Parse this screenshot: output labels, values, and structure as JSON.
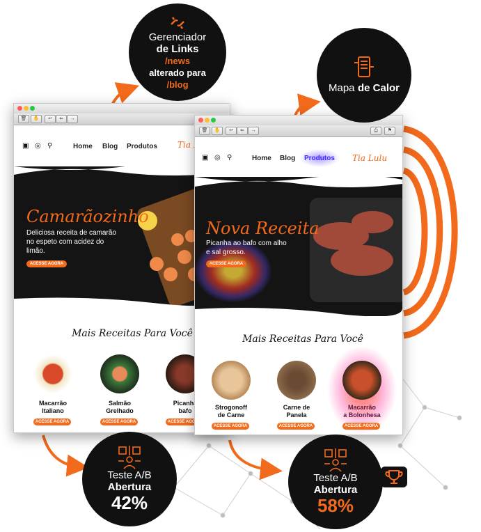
{
  "colors": {
    "accent": "#f26a1b",
    "dark": "#111111",
    "heat": "#6a4cff"
  },
  "callouts": {
    "links": {
      "line1": "Gerenciador",
      "line2": "de Links",
      "line3": "/news",
      "line4": "alterado para",
      "line5": "/blog",
      "icon": "broken-link-icon"
    },
    "heatmap": {
      "line1": "Mapa",
      "line2": "de Calor",
      "icon": "heatmap-phone-icon"
    },
    "test_a": {
      "line1": "Teste A/B",
      "line2": "Abertura",
      "value": "42%",
      "icon": "ab-test-icon"
    },
    "test_b": {
      "line1": "Teste A/B",
      "line2": "Abertura",
      "value": "58%",
      "icon": "ab-test-icon"
    },
    "trophy": {
      "icon": "trophy-icon"
    }
  },
  "window_a": {
    "nav": [
      "Home",
      "Blog",
      "Produtos"
    ],
    "brand": "Tia Lu",
    "hero": {
      "title": "Camarãozinho",
      "desc_line1": "Deliciosa receita de camarão",
      "desc_line2": "no espeto com acidez do",
      "desc_line3": "limão.",
      "cta": "ACESSE AGORA"
    },
    "section_title": "Mais Receitas Para Você",
    "cards": [
      {
        "name1": "Macarrão",
        "name2": "Italiano",
        "cta": "ACESSE AGORA"
      },
      {
        "name1": "Salmão",
        "name2": "Grelhado",
        "cta": "ACESSE AGORA"
      },
      {
        "name1": "Picanha",
        "name2": "bafo",
        "cta": "ACESSE AGORA"
      }
    ]
  },
  "window_b": {
    "nav": [
      "Home",
      "Blog",
      "Produtos"
    ],
    "brand": "Tia Lulu",
    "hero": {
      "title": "Nova Receita",
      "desc_line1": "Picanha ao bafo com alho",
      "desc_line2": "e sal grosso.",
      "cta": "ACESSE AGORA"
    },
    "section_title": "Mais Receitas Para Você",
    "cards": [
      {
        "name1": "Strogonoff",
        "name2": "de Carne",
        "cta": "ACESSE AGORA"
      },
      {
        "name1": "Carne de",
        "name2": "Panela",
        "cta": "ACESSE AGORA"
      },
      {
        "name1": "Macarrão",
        "name2": "a Bolonhesa",
        "cta": "ACESSE AGORA"
      }
    ]
  }
}
